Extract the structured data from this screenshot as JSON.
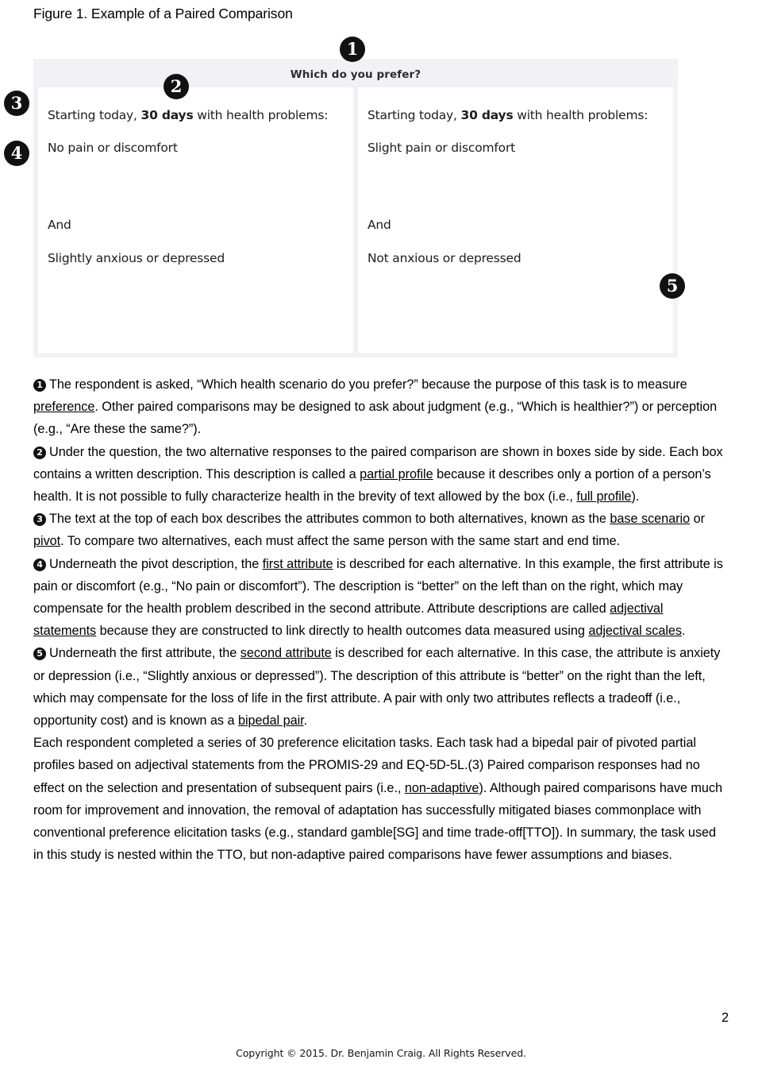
{
  "figure": {
    "caption": "Figure 1. Example of a Paired Comparison",
    "question": "Which do you prefer?",
    "panels": [
      {
        "pivot_prefix": "Starting today, ",
        "pivot_bold": "30 days",
        "pivot_suffix": " with health problems:",
        "attribute_1": "No pain or discomfort",
        "conjunction": "And",
        "attribute_2": "Slightly anxious or depressed"
      },
      {
        "pivot_prefix": "Starting today, ",
        "pivot_bold": "30 days",
        "pivot_suffix": " with health problems:",
        "attribute_1": "Slight pain or discomfort",
        "conjunction": "And",
        "attribute_2": "Not anxious or depressed"
      }
    ],
    "callouts": [
      "1",
      "2",
      "3",
      "4",
      "5"
    ],
    "background_color": "#f2f2f6",
    "panel_color": "#ffffff"
  },
  "body": {
    "item1": {
      "marker": "1",
      "text_a": "The respondent is asked, “Which health scenario do you prefer?” because the purpose of this task is to measure ",
      "underline_a": "preference",
      "text_b": ". Other paired comparisons may be designed to ask about judgment (e.g., “Which is healthier?”) or perception (e.g., “Are these the same?”)."
    },
    "item2": {
      "marker": "2",
      "text_a": "Under the question, the two alternative responses to the paired comparison are shown in boxes side by side. Each box contains a written description. This description is called a ",
      "underline_a": "partial profile",
      "text_b": " because it describes only a portion of a person’s health. It is not possible to fully characterize health in the brevity of text allowed by the box (i.e., ",
      "underline_b": "full profile",
      "text_c": ")."
    },
    "item3": {
      "marker": "3",
      "text_a": "The text at the top of each box describes the attributes common to both alternatives, known as the ",
      "underline_a": "base scenario",
      "text_b": " or ",
      "underline_b": "pivot",
      "text_c": ". To compare two alternatives, each must affect the same person with the same start and end time."
    },
    "item4": {
      "marker": "4",
      "text_a": "Underneath the pivot description, the ",
      "underline_a": "first attribute",
      "text_b": " is described for each alternative. In this example, the first attribute is pain or discomfort (e.g., “No pain or discomfort”). The description is “better” on the left than on the right, which may compensate for the health problem described in the second attribute. Attribute descriptions are called ",
      "underline_b": "adjectival statements",
      "text_c": " because they are constructed to link directly to health outcomes data measured using ",
      "underline_c": "adjectival scales",
      "text_d": "."
    },
    "item5": {
      "marker": "5",
      "text_a": "Underneath the first attribute, the ",
      "underline_a": "second attribute",
      "text_b": " is described for each alternative. In this case, the attribute is anxiety or depression (i.e., “Slightly anxious or depressed”). The description of this attribute is “better” on the right than the left, which may compensate for the loss of life in the first attribute. A pair with only two attributes reflects a tradeoff (i.e., opportunity cost) and is known as a ",
      "underline_b": "bipedal pair",
      "text_c": "."
    },
    "closing": {
      "text_a": "Each respondent completed a series of 30 preference elicitation tasks. Each task had a bipedal pair of pivoted partial profiles based on adjectival statements from the PROMIS-29 and EQ-5D-5L.(3) Paired comparison responses had no effect on the selection and presentation of subsequent pairs (i.e., ",
      "underline_a": "non-adaptive",
      "text_b": "). Although paired comparisons have much room for improvement and innovation, the removal of adaptation has successfully mitigated biases commonplace with conventional preference elicitation tasks (e.g., standard gamble[SG] and time trade-off[TTO]). In summary, the task used in this study is nested within the TTO, but non-adaptive paired comparisons have fewer assumptions and biases."
    }
  },
  "page_number": "2",
  "footer": "Copyright © 2015. Dr. Benjamin Craig. All Rights Reserved."
}
